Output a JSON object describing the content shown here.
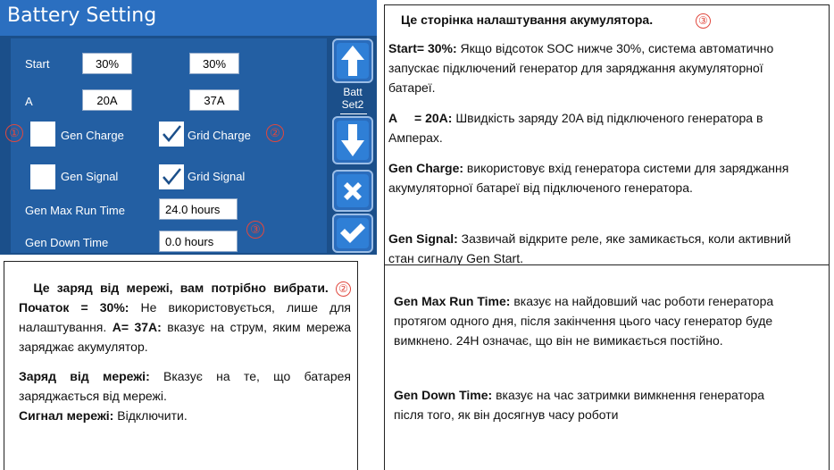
{
  "screen": {
    "title": "Battery Setting",
    "start_label": "Start",
    "start_gen": "30%",
    "start_grid": "30%",
    "a_label": "A",
    "a_gen": "20A",
    "a_grid": "37A",
    "gen_charge": "Gen Charge",
    "grid_charge": "Grid Charge",
    "gen_signal": "Gen Signal",
    "grid_signal": "Grid Signal",
    "gen_max_run_time_label": "Gen Max Run Time",
    "gen_max_run_time_value": "24.0 hours",
    "gen_down_time_label": "Gen Down Time",
    "gen_down_time_value": "0.0 hours",
    "batt_label_line1": "Batt",
    "batt_label_line2": "Set2",
    "markers": {
      "one": "①",
      "two": "②",
      "three": "③"
    }
  },
  "right_panel": {
    "heading": "Це сторінка налаштування акумулятора.",
    "marker": "③",
    "start_key": "Start= 30%:",
    "start_text": " Якщо відсоток SOC нижче 30%, система автоматично запускає підключений генератор для заряджання акумуляторної батареї.",
    "a_key": "A     = 20A:",
    "a_text": " Швидкість заряду 20A від підключеного генератора в Амперах.",
    "gen_charge_key": "Gen Charge:",
    "gen_charge_text": " використовує вхід генератора системи для заряджання акумуляторної батареї від підключеного генератора.",
    "gen_signal_key": "Gen Signal:",
    "gen_signal_text": " Зазвичай відкрите реле, яке замикається, коли активний стан сигналу Gen Start.",
    "gen_max_key": "Gen Max Run Time:",
    "gen_max_text": " вказує на найдовший час роботи генератора протягом одного дня, після закінчення цього часу генератор буде вимкнено. 24H означає, що він не вимикається постійно.",
    "gen_down_key": "Gen Down Time:",
    "gen_down_text": " вказує на час затримки вимкнення генератора після того, як він досягнув часу роботи"
  },
  "left_panel": {
    "heading": "Це заряд від мережі, вам потрібно вибрати.",
    "marker": "②",
    "start_key": "Початок = 30%:",
    "start_text": " Не використовується, лише для налаштування.",
    "a_key": "A= 37A:",
    "a_text": " вказує на струм, яким мережа заряджає акумулятор.",
    "grid_charge_key": "Заряд від мережі:",
    "grid_charge_text": " Вказує на те, що батарея заряджається від мережі.",
    "grid_signal_key": "Сигнал мережі:",
    "grid_signal_text": " Відключити."
  },
  "colors": {
    "screen_bg": "#1b4f8a",
    "titlebar": "#2b6fc0",
    "panel": "#235fa3",
    "marker_red": "#e0483e"
  },
  "icons": [
    "arrow-up-icon",
    "arrow-down-icon",
    "close-icon",
    "checkmark-icon",
    "checkbox-checked-icon"
  ]
}
